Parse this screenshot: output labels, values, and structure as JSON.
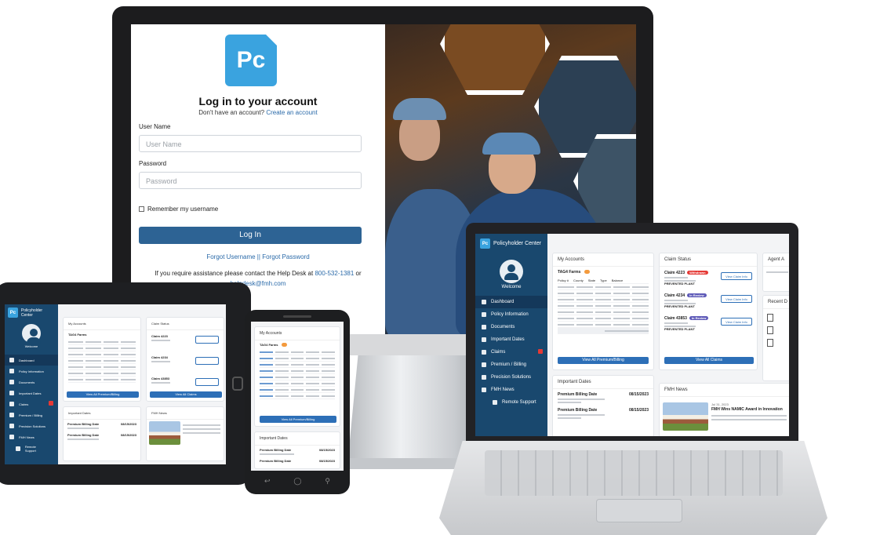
{
  "login": {
    "logo_text": "Pc",
    "title": "Log in to your account",
    "no_account_text": "Don't have an account?",
    "create_account_link": "Create an account",
    "username_label": "User Name",
    "username_placeholder": "User Name",
    "password_label": "Password",
    "password_placeholder": "Password",
    "remember_label": "Remember my username",
    "login_button": "Log In",
    "forgot_username": "Forgot Username",
    "forgot_separator": " || ",
    "forgot_password": "Forgot Password",
    "help_text": "If you require assistance please contact the Help Desk at",
    "help_phone": "800-532-1381",
    "help_or": " or ",
    "help_email": "helpdesk@fmh.com"
  },
  "dashboard": {
    "app_title": "Policyholder Center",
    "welcome": "Welcome",
    "nav": [
      {
        "label": "Dashboard",
        "active": true
      },
      {
        "label": "Policy Information"
      },
      {
        "label": "Documents"
      },
      {
        "label": "Important Dates"
      },
      {
        "label": "Claims",
        "badge": true
      },
      {
        "label": "Premium / Billing"
      },
      {
        "label": "Precision Solutions"
      },
      {
        "label": "FMH News"
      }
    ],
    "remote_support": "Remote Support",
    "my_accounts_title": "My Accounts",
    "account_name": "TAG4 Farms",
    "account_columns": [
      "Policy #",
      "County",
      "State",
      "Type",
      "Balance"
    ],
    "view_premium_billing": "View All Premium/Billing",
    "claim_status_title": "Claim Status",
    "claims": [
      {
        "id": "Claim 4223",
        "status": "Withdrawn"
      },
      {
        "id": "Claim 4234",
        "status": "In Review"
      },
      {
        "id": "Claim 43853",
        "status": "In Review"
      }
    ],
    "claim_desc": "PREVENTED PLANT",
    "view_claim_info": "View Claim Info",
    "view_all_claims": "View All Claims",
    "agent_title": "Agent A",
    "recent_title": "Recent D",
    "important_dates_title": "Important Dates",
    "dates": [
      {
        "label": "Premium Billing Date",
        "date": "08/15/2023"
      },
      {
        "label": "Premium Billing Date",
        "date": "08/15/2023"
      }
    ],
    "news_title": "FMH News",
    "news_date": "Jul 31, 2023",
    "news_headline": "FMH Wins NAMIC Award in Innovation"
  },
  "colors": {
    "brand_blue": "#3aa3df",
    "sidebar": "#19486e",
    "login_button": "#2d6394",
    "withdrawn": "#e53935",
    "in_review": "#5e5ab8"
  }
}
